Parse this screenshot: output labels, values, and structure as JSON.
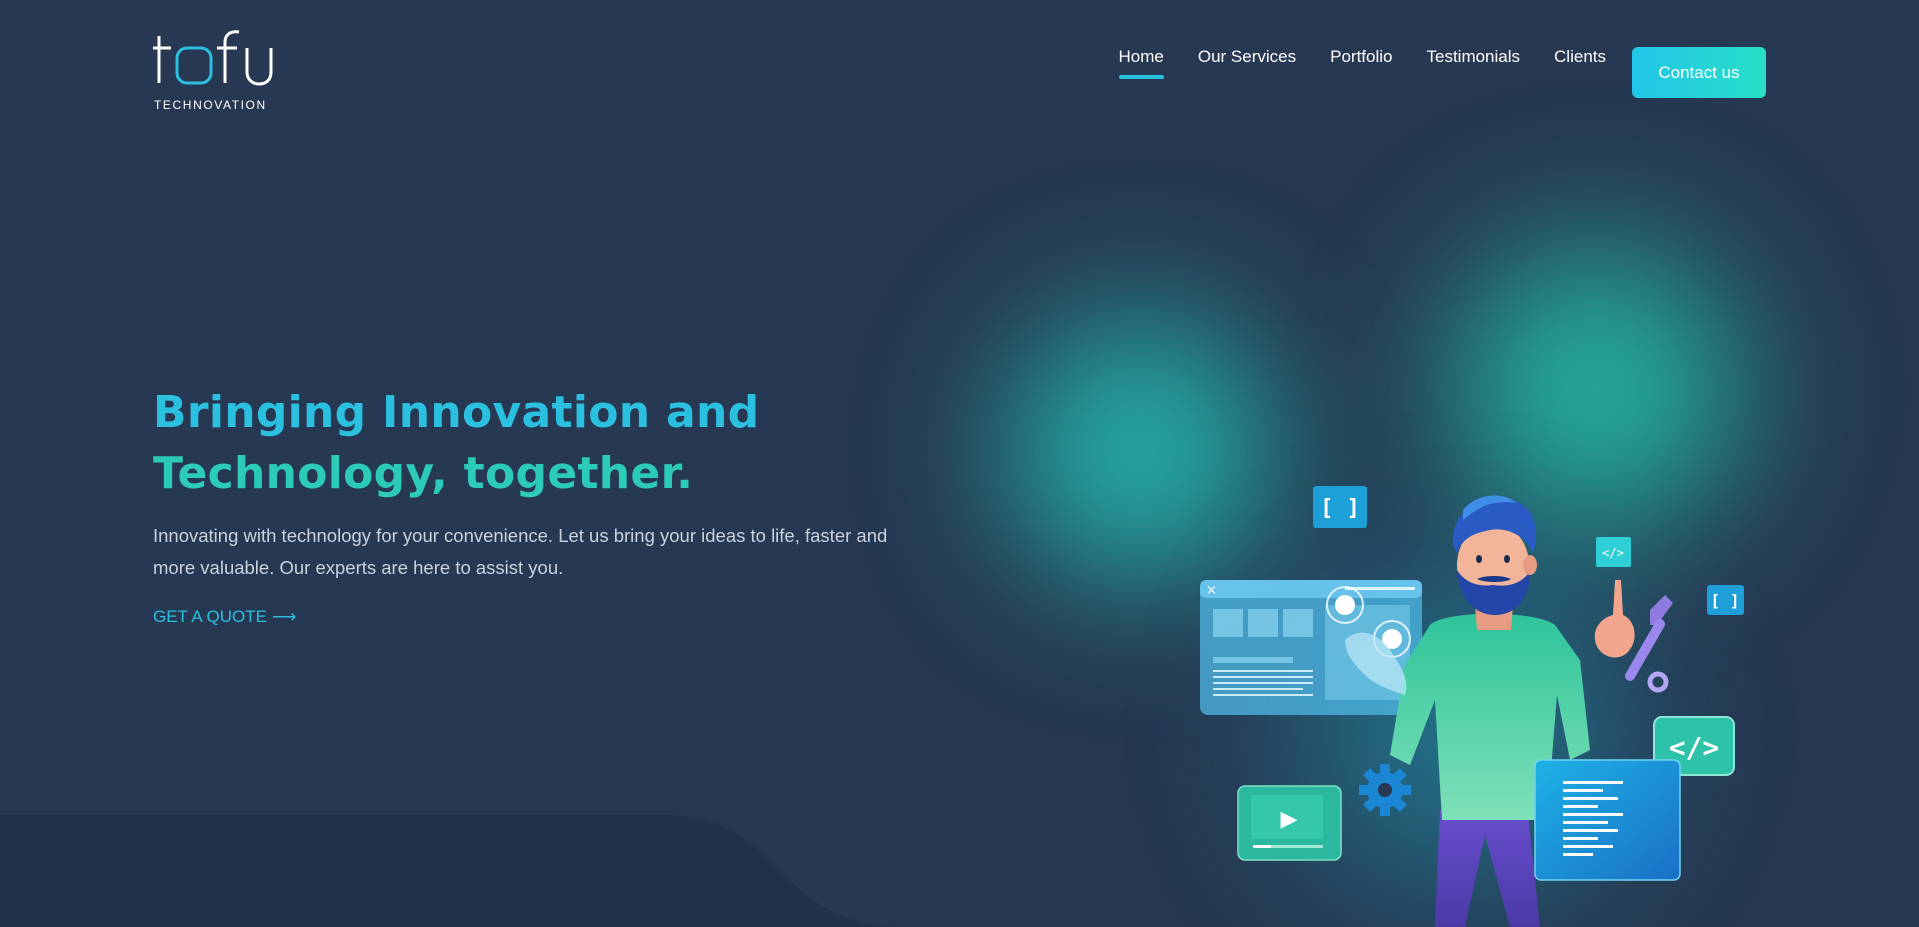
{
  "brand": {
    "wordmark": "tofu",
    "tagline": "TECHNOVATION"
  },
  "nav": {
    "items": [
      {
        "label": "Home",
        "active": true
      },
      {
        "label": "Our Services",
        "active": false
      },
      {
        "label": "Portfolio",
        "active": false
      },
      {
        "label": "Testimonials",
        "active": false
      },
      {
        "label": "Clients",
        "active": false
      }
    ],
    "contact_label": "Contact us"
  },
  "hero": {
    "title_line1": "Bringing Innovation and",
    "title_line2": "Technology, together.",
    "text": "Innovating with technology for your convenience. Let us bring your ideas to life, faster and more valuable. Our experts are here to assist you.",
    "cta_label": "GET A QUOTE",
    "cta_arrow": "⟶"
  },
  "illustration": {
    "code_badge_small": "</>",
    "code_badge_large": "</>",
    "bracket_badge": "[ ]",
    "close_glyph": "×",
    "play_glyph": "▶"
  },
  "colors": {
    "background": "#263852",
    "accent_cyan": "#2cc0e0",
    "accent_teal": "#2ccab8",
    "glow": "#24d2be"
  }
}
